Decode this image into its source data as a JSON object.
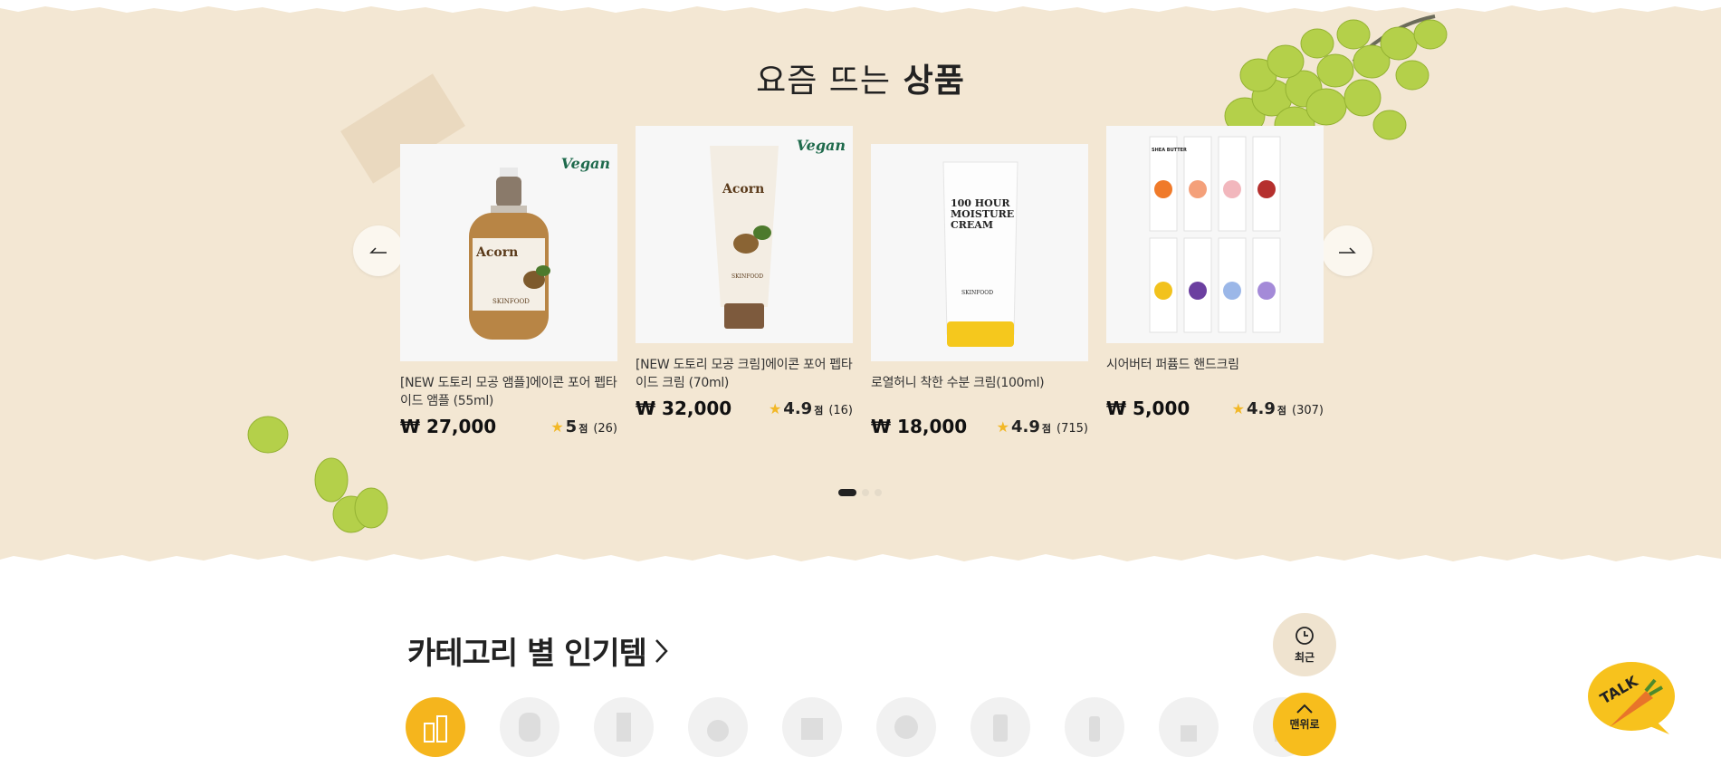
{
  "section": {
    "title_light": "요즘 뜨는",
    "title_bold": "상품"
  },
  "carousel": {
    "prev_icon": "arrow-left-icon",
    "next_icon": "arrow-right-icon",
    "pages": 3,
    "active_page": 1
  },
  "products": [
    {
      "name": "[NEW 도토리 모공 앰플]에이콘 포어 펩타이드 앰플 (55ml)",
      "price": "₩ 27,000",
      "score": "5",
      "unit": "점",
      "count": "(26)",
      "vegan": "Vegan",
      "image_label": "Acorn",
      "brand": "SKINFOOD"
    },
    {
      "name": "[NEW 도토리 모공 크림]에이콘 포어 펩타이드 크림 (70ml)",
      "price": "₩ 32,000",
      "score": "4.9",
      "unit": "점",
      "count": "(16)",
      "vegan": "Vegan",
      "image_label": "Acorn",
      "brand": "SKINFOOD"
    },
    {
      "name": "로열허니 착한 수분 크림(100ml)",
      "price": "₩ 18,000",
      "score": "4.9",
      "unit": "점",
      "count": "(715)",
      "image_label": "100 HOUR MOISTURE CREAM",
      "brand": "SKINFOOD"
    },
    {
      "name": "시어버터 퍼퓸드 핸드크림",
      "price": "₩ 5,000",
      "score": "4.9",
      "unit": "점",
      "count": "(307)",
      "image_label": "SHEA BUTTER"
    }
  ],
  "category": {
    "title": "카테고리 별 인기템",
    "chevron_icon": "chevron-right-icon"
  },
  "floating": {
    "recent_label": "최근",
    "top_label": "맨위로",
    "talk_label": "TALK"
  },
  "colors": {
    "hero_bg": "#f3e7d3",
    "accent_yellow": "#f5b51d",
    "star": "#f2b827"
  }
}
